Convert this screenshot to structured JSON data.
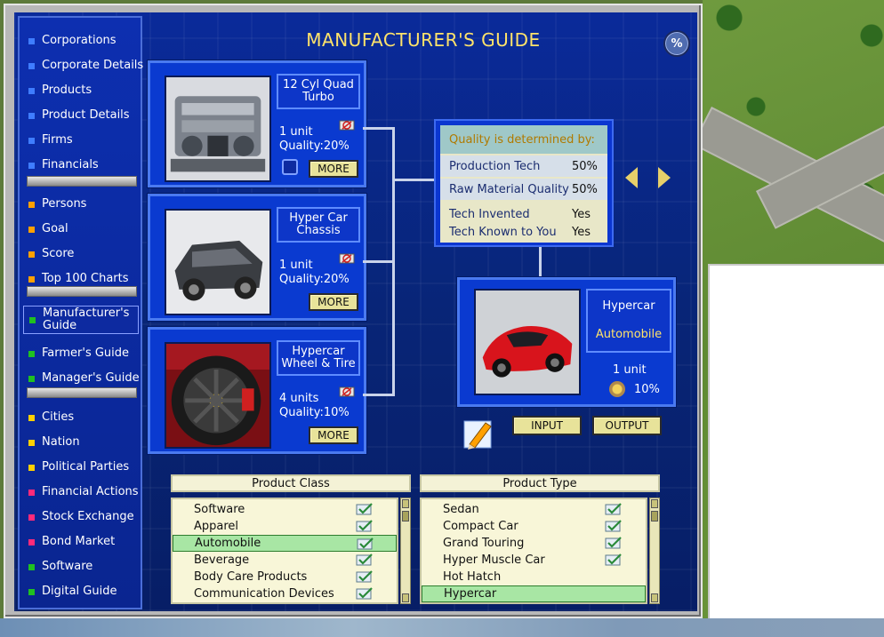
{
  "title": "MANUFACTURER'S GUIDE",
  "percent_badge": "%",
  "sidebar": {
    "items": [
      {
        "label": "Corporations",
        "color": "#3f7dff"
      },
      {
        "label": "Corporate Details",
        "color": "#3f7dff"
      },
      {
        "label": "Products",
        "color": "#3f7dff"
      },
      {
        "label": "Product Details",
        "color": "#3f7dff"
      },
      {
        "label": "Firms",
        "color": "#3f7dff"
      },
      {
        "label": "Financials",
        "color": "#3f7dff"
      },
      {
        "label": "Persons",
        "color": "#ffa000"
      },
      {
        "label": "Goal",
        "color": "#ffa000"
      },
      {
        "label": "Score",
        "color": "#ffa000"
      },
      {
        "label": "Top 100 Charts",
        "color": "#ffa000"
      },
      {
        "label": "Manufacturer's Guide",
        "color": "#20c020"
      },
      {
        "label": "Farmer's Guide",
        "color": "#20c020"
      },
      {
        "label": "Manager's Guide",
        "color": "#20c020"
      },
      {
        "label": "Cities",
        "color": "#ffd000"
      },
      {
        "label": "Nation",
        "color": "#ffd000"
      },
      {
        "label": "Political Parties",
        "color": "#ffd000"
      },
      {
        "label": "Financial Actions",
        "color": "#ff2a7a"
      },
      {
        "label": "Stock Exchange",
        "color": "#ff2a7a"
      },
      {
        "label": "Bond Market",
        "color": "#ff2a7a"
      },
      {
        "label": "Software",
        "color": "#20c020"
      },
      {
        "label": "Digital Guide",
        "color": "#20c020"
      }
    ]
  },
  "inputs": [
    {
      "name": "12 Cyl Quad Turbo",
      "units": "1 unit",
      "quality": "Quality:20%",
      "more": "MORE",
      "image": "engine-image"
    },
    {
      "name": "Hyper Car Chassis",
      "units": "1 unit",
      "quality": "Quality:20%",
      "more": "MORE",
      "image": "chassis-image"
    },
    {
      "name": "Hypercar Wheel & Tire",
      "units": "4 units",
      "quality": "Quality:10%",
      "more": "MORE",
      "image": "wheel-image"
    }
  ],
  "quality_box": {
    "header": "Quality is determined by:",
    "rows": [
      {
        "label": "Production Tech",
        "value": "50%"
      },
      {
        "label": "Raw Material Quality",
        "value": "50%"
      },
      {
        "label": "Tech Invented",
        "value": "Yes"
      },
      {
        "label": "Tech Known to You",
        "value": "Yes"
      }
    ]
  },
  "output": {
    "name_line1": "Hypercar",
    "name_line2": "Automobile",
    "units": "1 unit",
    "percent": "10%"
  },
  "buttons": {
    "input": "INPUT",
    "output": "OUTPUT"
  },
  "product_class": {
    "header": "Product Class",
    "items": [
      {
        "label": "Software",
        "checked": true,
        "selected": false
      },
      {
        "label": "Apparel",
        "checked": true,
        "selected": false
      },
      {
        "label": "Automobile",
        "checked": true,
        "selected": true
      },
      {
        "label": "Beverage",
        "checked": true,
        "selected": false
      },
      {
        "label": "Body Care Products",
        "checked": true,
        "selected": false
      },
      {
        "label": "Communication Devices",
        "checked": true,
        "selected": false
      }
    ]
  },
  "product_type": {
    "header": "Product Type",
    "items": [
      {
        "label": "Sedan",
        "checked": true,
        "selected": false
      },
      {
        "label": "Compact Car",
        "checked": true,
        "selected": false
      },
      {
        "label": "Grand Touring",
        "checked": true,
        "selected": false
      },
      {
        "label": "Hyper Muscle Car",
        "checked": true,
        "selected": false
      },
      {
        "label": "Hot Hatch",
        "checked": false,
        "selected": false
      },
      {
        "label": "Hypercar",
        "checked": false,
        "selected": true
      }
    ]
  }
}
